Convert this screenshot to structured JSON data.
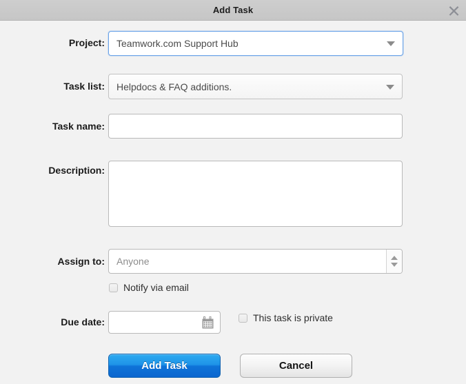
{
  "window": {
    "title": "Add Task",
    "close_icon": "close-x-icon"
  },
  "form": {
    "project": {
      "label": "Project:",
      "value": "Teamwork.com Support Hub",
      "caret_icon": "chevron-down-icon",
      "focused": true
    },
    "task_list": {
      "label": "Task list:",
      "value": "Helpdocs & FAQ additions.",
      "caret_icon": "chevron-down-icon",
      "focused": false
    },
    "task_name": {
      "label": "Task name:",
      "value": "",
      "placeholder": ""
    },
    "description": {
      "label": "Description:",
      "value": "",
      "placeholder": ""
    },
    "assign_to": {
      "label": "Assign to:",
      "value": "",
      "placeholder": "Anyone",
      "spinner_up_icon": "triangle-up-icon",
      "spinner_down_icon": "triangle-down-icon"
    },
    "notify_via_email": {
      "label": "Notify via email",
      "checked": false
    },
    "due_date": {
      "label": "Due date:",
      "value": "",
      "placeholder": "",
      "calendar_icon": "calendar-icon"
    },
    "task_private": {
      "label": "This task is private",
      "checked": false
    }
  },
  "actions": {
    "submit_label": "Add Task",
    "cancel_label": "Cancel"
  },
  "colors": {
    "titlebar": "#c8c8c8",
    "body": "#f2f2f2",
    "primary_button": "#1280e0",
    "focus_border": "#6aa3e8",
    "field_border": "#b9b9b9",
    "label_text": "#1a1a1a",
    "placeholder_text": "#8c8c8c"
  }
}
